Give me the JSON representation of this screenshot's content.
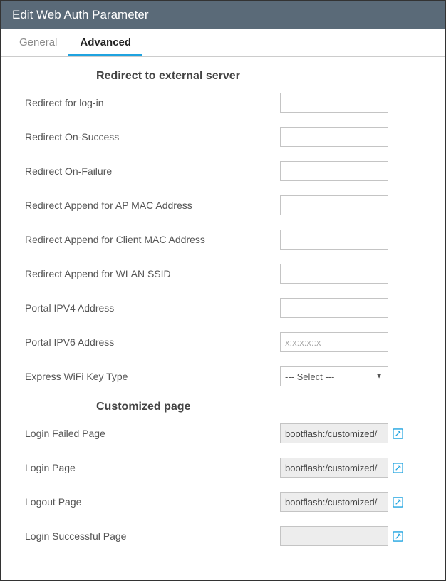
{
  "header": {
    "title": "Edit Web Auth Parameter"
  },
  "tabs": {
    "general": "General",
    "advanced": "Advanced",
    "active": "advanced"
  },
  "sections": {
    "redirect": {
      "title": "Redirect to external server",
      "fields": [
        {
          "label": "Redirect for log-in",
          "value": ""
        },
        {
          "label": "Redirect On-Success",
          "value": ""
        },
        {
          "label": "Redirect On-Failure",
          "value": ""
        },
        {
          "label": "Redirect Append for AP MAC Address",
          "value": ""
        },
        {
          "label": "Redirect Append for Client MAC Address",
          "value": ""
        },
        {
          "label": "Redirect Append for WLAN SSID",
          "value": ""
        },
        {
          "label": "Portal IPV4 Address",
          "value": ""
        },
        {
          "label": "Portal IPV6 Address",
          "value": "",
          "placeholder": "x:x:x:x::x"
        }
      ],
      "express_wifi": {
        "label": "Express WiFi Key Type",
        "selected": "--- Select ---"
      }
    },
    "customized": {
      "title": "Customized page",
      "fields": [
        {
          "label": "Login Failed Page",
          "value": "bootflash:/customized/"
        },
        {
          "label": "Login Page",
          "value": "bootflash:/customized/"
        },
        {
          "label": "Logout Page",
          "value": "bootflash:/customized/"
        },
        {
          "label": "Login Successful Page",
          "value": ""
        }
      ]
    }
  }
}
